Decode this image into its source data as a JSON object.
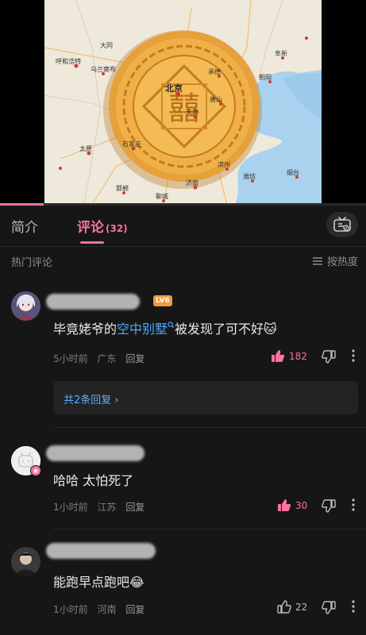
{
  "video": {
    "map_labels": [
      "呼和浩特",
      "乌兰察布",
      "承德",
      "阜新",
      "北京",
      "天津",
      "唐山",
      "石家庄",
      "太原",
      "济南",
      "烟台",
      "潍坊",
      "邯郸",
      "朝阳",
      "大同",
      "滨州",
      "聊城"
    ],
    "mooncake_glyph": "囍",
    "progress": 0.12
  },
  "tabs": {
    "intro_label": "简介",
    "comments_label": "评论",
    "comments_count": "(32)",
    "tv_icon": "tv-icon"
  },
  "section": {
    "hot_title": "热门评论",
    "sort_label": "按热度"
  },
  "comments": [
    {
      "level": "LV6",
      "text_before": "毕竟姥爷的",
      "keyword": "空中别墅",
      "text_after": "被发现了可不好",
      "emoji": "🐱",
      "time": "5小时前",
      "location": "广东",
      "reply_label": "回复",
      "likes": "182",
      "liked": true,
      "replies_link": "共2条回复 ›"
    },
    {
      "text": "哈哈  太怕死了",
      "time": "1小时前",
      "location": "江苏",
      "reply_label": "回复",
      "likes": "30",
      "liked": true
    },
    {
      "text": "能跑早点跑吧😂",
      "time": "1小时前",
      "location": "河南",
      "reply_label": "回复",
      "likes": "22",
      "liked": false
    }
  ],
  "colors": {
    "accent": "#fb7299",
    "link": "#4fa7ff",
    "bg": "#161616"
  }
}
